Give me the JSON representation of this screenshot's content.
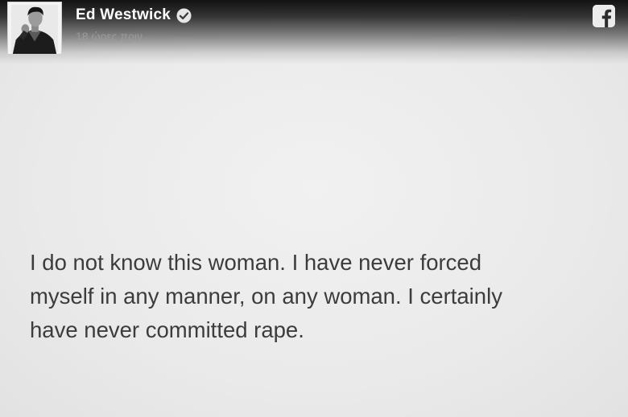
{
  "post": {
    "author": {
      "name": "Ed Westwick",
      "verified": true,
      "avatar_icon": "profile-photo"
    },
    "timestamp": "18 ώρες πριν",
    "platform_icon": "facebook-icon",
    "statement_lines": [
      "I do not know this woman. I have never forced",
      "myself in any manner, on any woman. I certainly",
      "have never committed rape."
    ]
  },
  "colors": {
    "header_gradient": "#000000",
    "name_text": "#ffffff",
    "timestamp_text": "#9a9a9a",
    "body_text": "#3c3c3c",
    "background": "#ececec"
  }
}
